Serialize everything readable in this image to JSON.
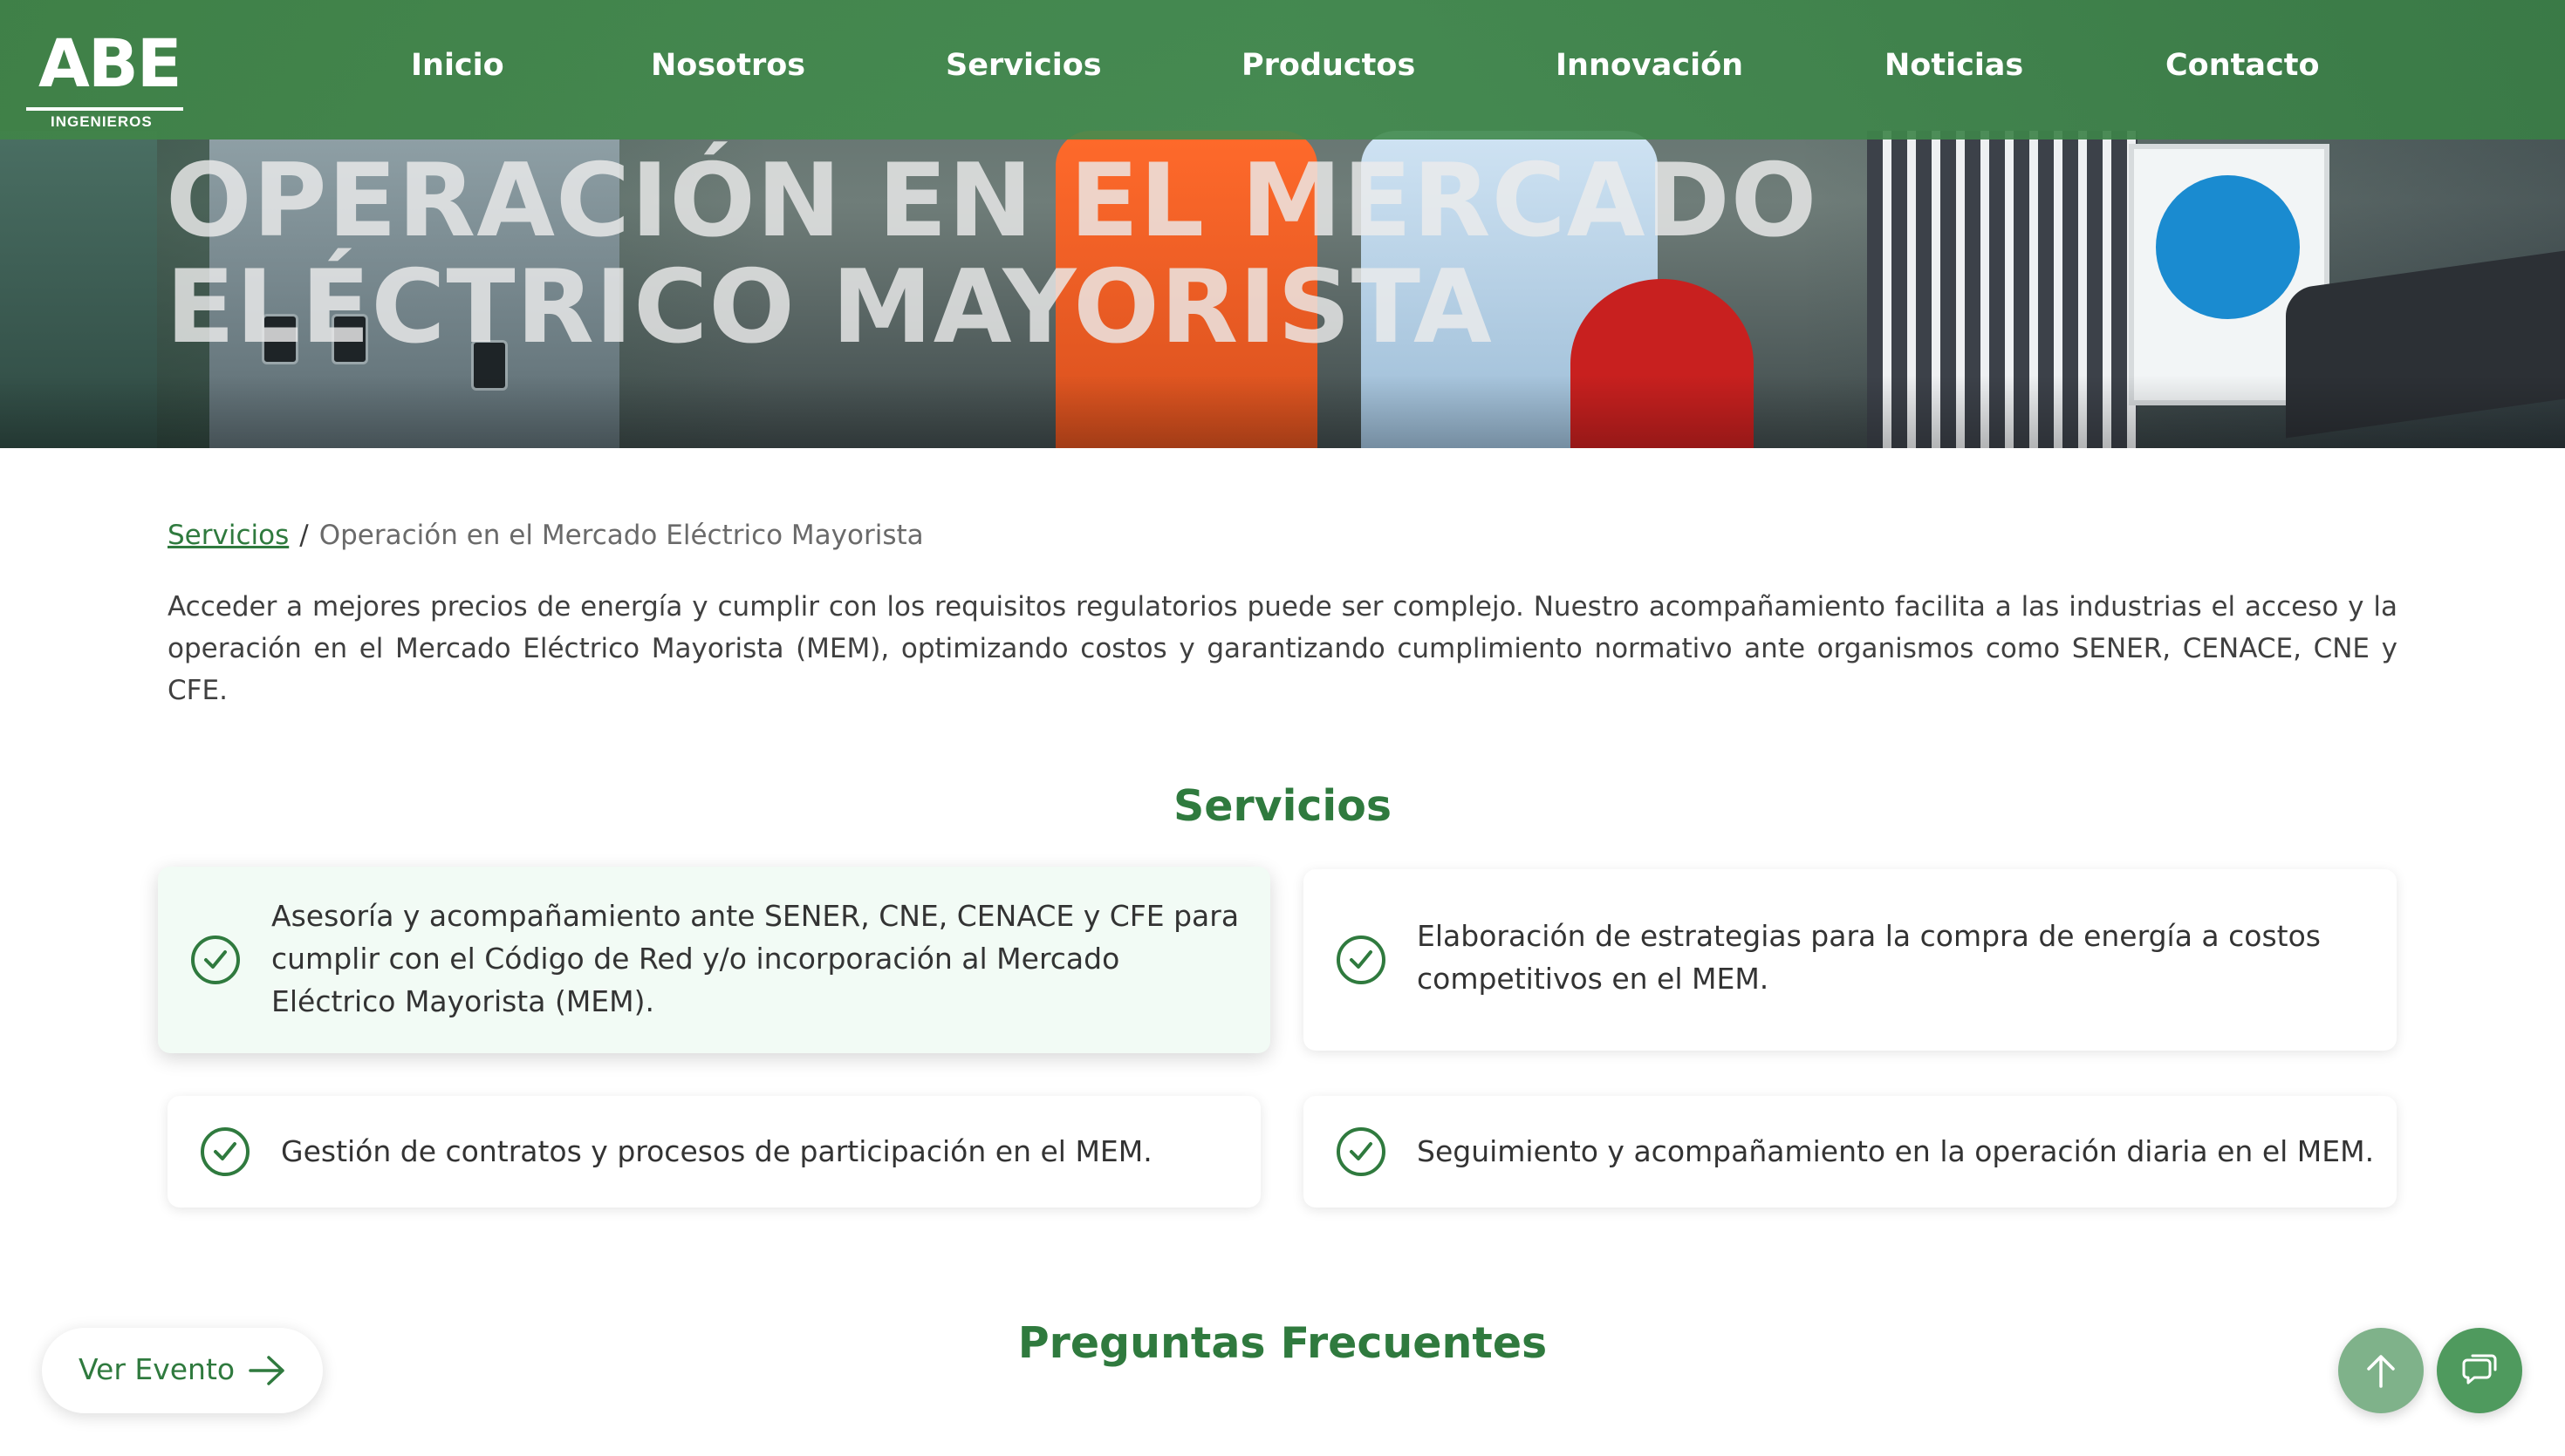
{
  "brand": {
    "logo_main": "ABE",
    "logo_sub": "INGENIEROS"
  },
  "nav": {
    "items": [
      {
        "label": "Inicio"
      },
      {
        "label": "Nosotros"
      },
      {
        "label": "Servicios"
      },
      {
        "label": "Productos"
      },
      {
        "label": "Innovación"
      },
      {
        "label": "Noticias"
      },
      {
        "label": "Contacto"
      }
    ]
  },
  "hero": {
    "title_line1": "OPERACIÓN EN EL MERCADO",
    "title_line2": "ELÉCTRICO MAYORISTA"
  },
  "breadcrumb": {
    "parent": "Servicios",
    "separator": "/",
    "current": "Operación en el Mercado Eléctrico Mayorista"
  },
  "intro": "Acceder a mejores precios de energía y cumplir con los requisitos regulatorios puede ser complejo. Nuestro acompañamiento facilita a las industrias el acceso y la operación en el Mercado Eléctrico Mayorista (MEM), optimizando costos y garantizando cumplimiento normativo ante organismos como SENER, CENACE, CNE y CFE.",
  "services": {
    "title": "Servicios",
    "items": [
      {
        "text": "Asesoría y acompañamiento ante SENER, CNE, CENACE y CFE para cumplir con el Código de Red y/o incorporación al Mercado Eléctrico Mayorista (MEM).",
        "icon": "check-circle-icon"
      },
      {
        "text": "Elaboración de estrategias para la compra de energía a costos competitivos en el MEM.",
        "icon": "check-circle-icon"
      },
      {
        "text": "Gestión de contratos y procesos de participación en el MEM.",
        "icon": "check-circle-icon"
      },
      {
        "text": "Seguimiento y acompañamiento en la operación diaria en el MEM.",
        "icon": "check-circle-icon"
      }
    ]
  },
  "faq": {
    "title": "Preguntas Frecuentes"
  },
  "floating": {
    "ver_evento_label": "Ver Evento",
    "ver_evento_icon": "arrow-right-icon",
    "scroll_top_icon": "arrow-up-icon",
    "chat_icon": "chat-icon"
  },
  "colors": {
    "brand_green": "#2f7a3e",
    "nav_green": "#428c4e",
    "active_card_bg": "#f2fbf5"
  }
}
